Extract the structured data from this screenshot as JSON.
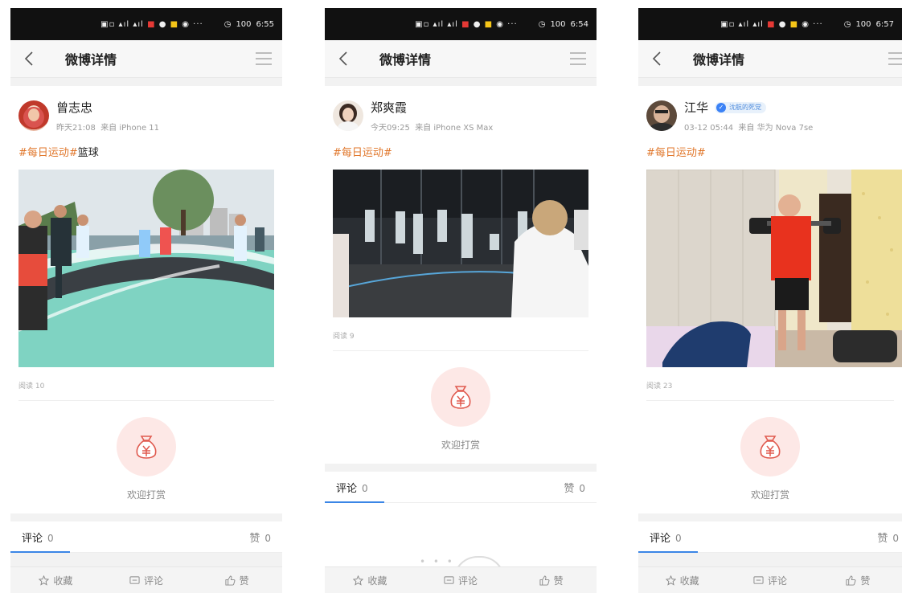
{
  "phones": [
    {
      "status_time": "6:55",
      "battery": "100",
      "nav_title": "微博详情",
      "user_name": "曾志忠",
      "meta_time": "昨天21:08",
      "meta_source": "来自 iPhone 11",
      "topic_tag": "#每日运动#",
      "topic_text": "篮球",
      "reads": "阅读 10",
      "reward_label": "欢迎打赏",
      "comments_label": "评论",
      "comments_count": "0",
      "likes_label": "赞",
      "likes_count": "0",
      "bottom": {
        "fav": "收藏",
        "comment": "评论",
        "like": "赞"
      }
    },
    {
      "status_time": "6:54",
      "battery": "100",
      "nav_title": "微博详情",
      "user_name": "郑爽霞",
      "meta_time": "今天09:25",
      "meta_source": "来自 iPhone XS Max",
      "topic_tag": "#每日运动#",
      "topic_text": "",
      "reads": "阅读 9",
      "reward_label": "欢迎打赏",
      "comments_label": "评论",
      "comments_count": "0",
      "likes_label": "赞",
      "likes_count": "0",
      "loading_dots": "• • •",
      "bottom": {
        "fav": "收藏",
        "comment": "评论",
        "like": "赞"
      }
    },
    {
      "status_time": "6:57",
      "battery": "100",
      "nav_title": "微博详情",
      "user_name": "江华",
      "badge": "沈航的死党",
      "meta_time": "03-12 05:44",
      "meta_source": "来自 华为 Nova 7se",
      "topic_tag": "#每日运动#",
      "topic_text": "",
      "reads": "阅读 23",
      "reward_label": "欢迎打赏",
      "comments_label": "评论",
      "comments_count": "0",
      "likes_label": "赞",
      "likes_count": "0",
      "bottom": {
        "fav": "收藏",
        "comment": "评论",
        "like": "赞"
      }
    }
  ],
  "colors": {
    "accent_blue": "#3b86e6",
    "topic_orange": "#e0762a",
    "reward_pink": "#fde8e6",
    "reward_red": "#e05a4f"
  },
  "icons": [
    "chevron-left-icon",
    "hamburger-menu-icon",
    "money-bag-icon",
    "star-icon",
    "comment-icon",
    "thumbs-up-icon",
    "verified-icon"
  ]
}
